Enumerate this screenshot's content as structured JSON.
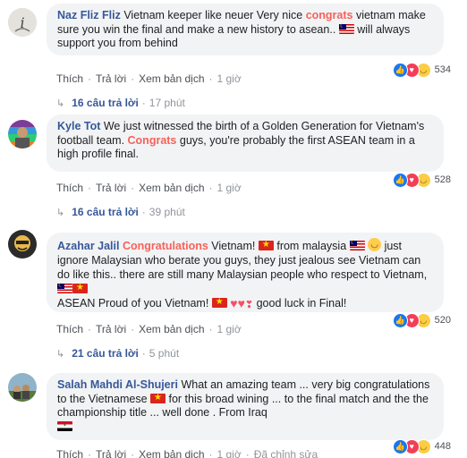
{
  "comments": [
    {
      "author": "Naz Fliz Fliz",
      "text_a": " Vietnam keeper like neuer Very nice ",
      "highlight": "congrats",
      "text_b": " vietnam make sure you win the final and make a new history to asean.. ",
      "text_c": " will always support you from behind",
      "actions": {
        "like": "Thích",
        "reply": "Trả lời",
        "translate": "Xem bản dịch",
        "time": "1 giờ"
      },
      "reaction_count": "534",
      "replies": {
        "count": "16 câu trả lời",
        "time": "17 phút"
      }
    },
    {
      "author": "Kyle Tot",
      "text_a": " We just witnessed the birth of a Golden Generation for Vietnam's football team. ",
      "highlight": "Congrats",
      "text_b": " guys, you're probably the first ASEAN team in a high profile final.",
      "actions": {
        "like": "Thích",
        "reply": "Trả lời",
        "translate": "Xem bản dịch",
        "time": "1 giờ"
      },
      "reaction_count": "528",
      "replies": {
        "count": "16 câu trả lời",
        "time": "39 phút"
      }
    },
    {
      "author": "Azahar Jalil",
      "highlight": "Congratulations",
      "text_a": " Vietnam! ",
      "text_b": " from malaysia ",
      "text_c": " just ignore Malaysian who berate you guys, they just jealous see Vietnam can do like this.. there are still many Malaysian people who respect to Vietnam, ",
      "text_d": "ASEAN Proud of you Vietnam! ",
      "text_e": " good luck in Final!",
      "actions": {
        "like": "Thích",
        "reply": "Trả lời",
        "translate": "Xem bản dịch",
        "time": "1 giờ"
      },
      "reaction_count": "520",
      "replies": {
        "count": "21 câu trả lời",
        "time": "5 phút"
      }
    },
    {
      "author": "Salah Mahdi Al-Shujeri",
      "text_a": " What an amazing team ... very big congratulations to the Vietnamese ",
      "text_b": " for this broad wining ... to the final match and the the championship title ... well done . From Iraq",
      "actions": {
        "like": "Thích",
        "reply": "Trả lời",
        "translate": "Xem bản dịch",
        "time": "1 giờ",
        "edited": "Đã chỉnh sửa"
      },
      "reaction_count": "448"
    }
  ],
  "colors": {
    "author": "#365899",
    "highlight": "#f7625a",
    "bubble": "#f2f3f5",
    "like": "#1877f2",
    "love": "#f33e58",
    "haha": "#fbcd44"
  },
  "icons": {
    "reply_arrow": "reply-arrow-icon",
    "like": "like-reaction-icon",
    "love": "love-reaction-icon",
    "haha": "haha-reaction-icon"
  }
}
